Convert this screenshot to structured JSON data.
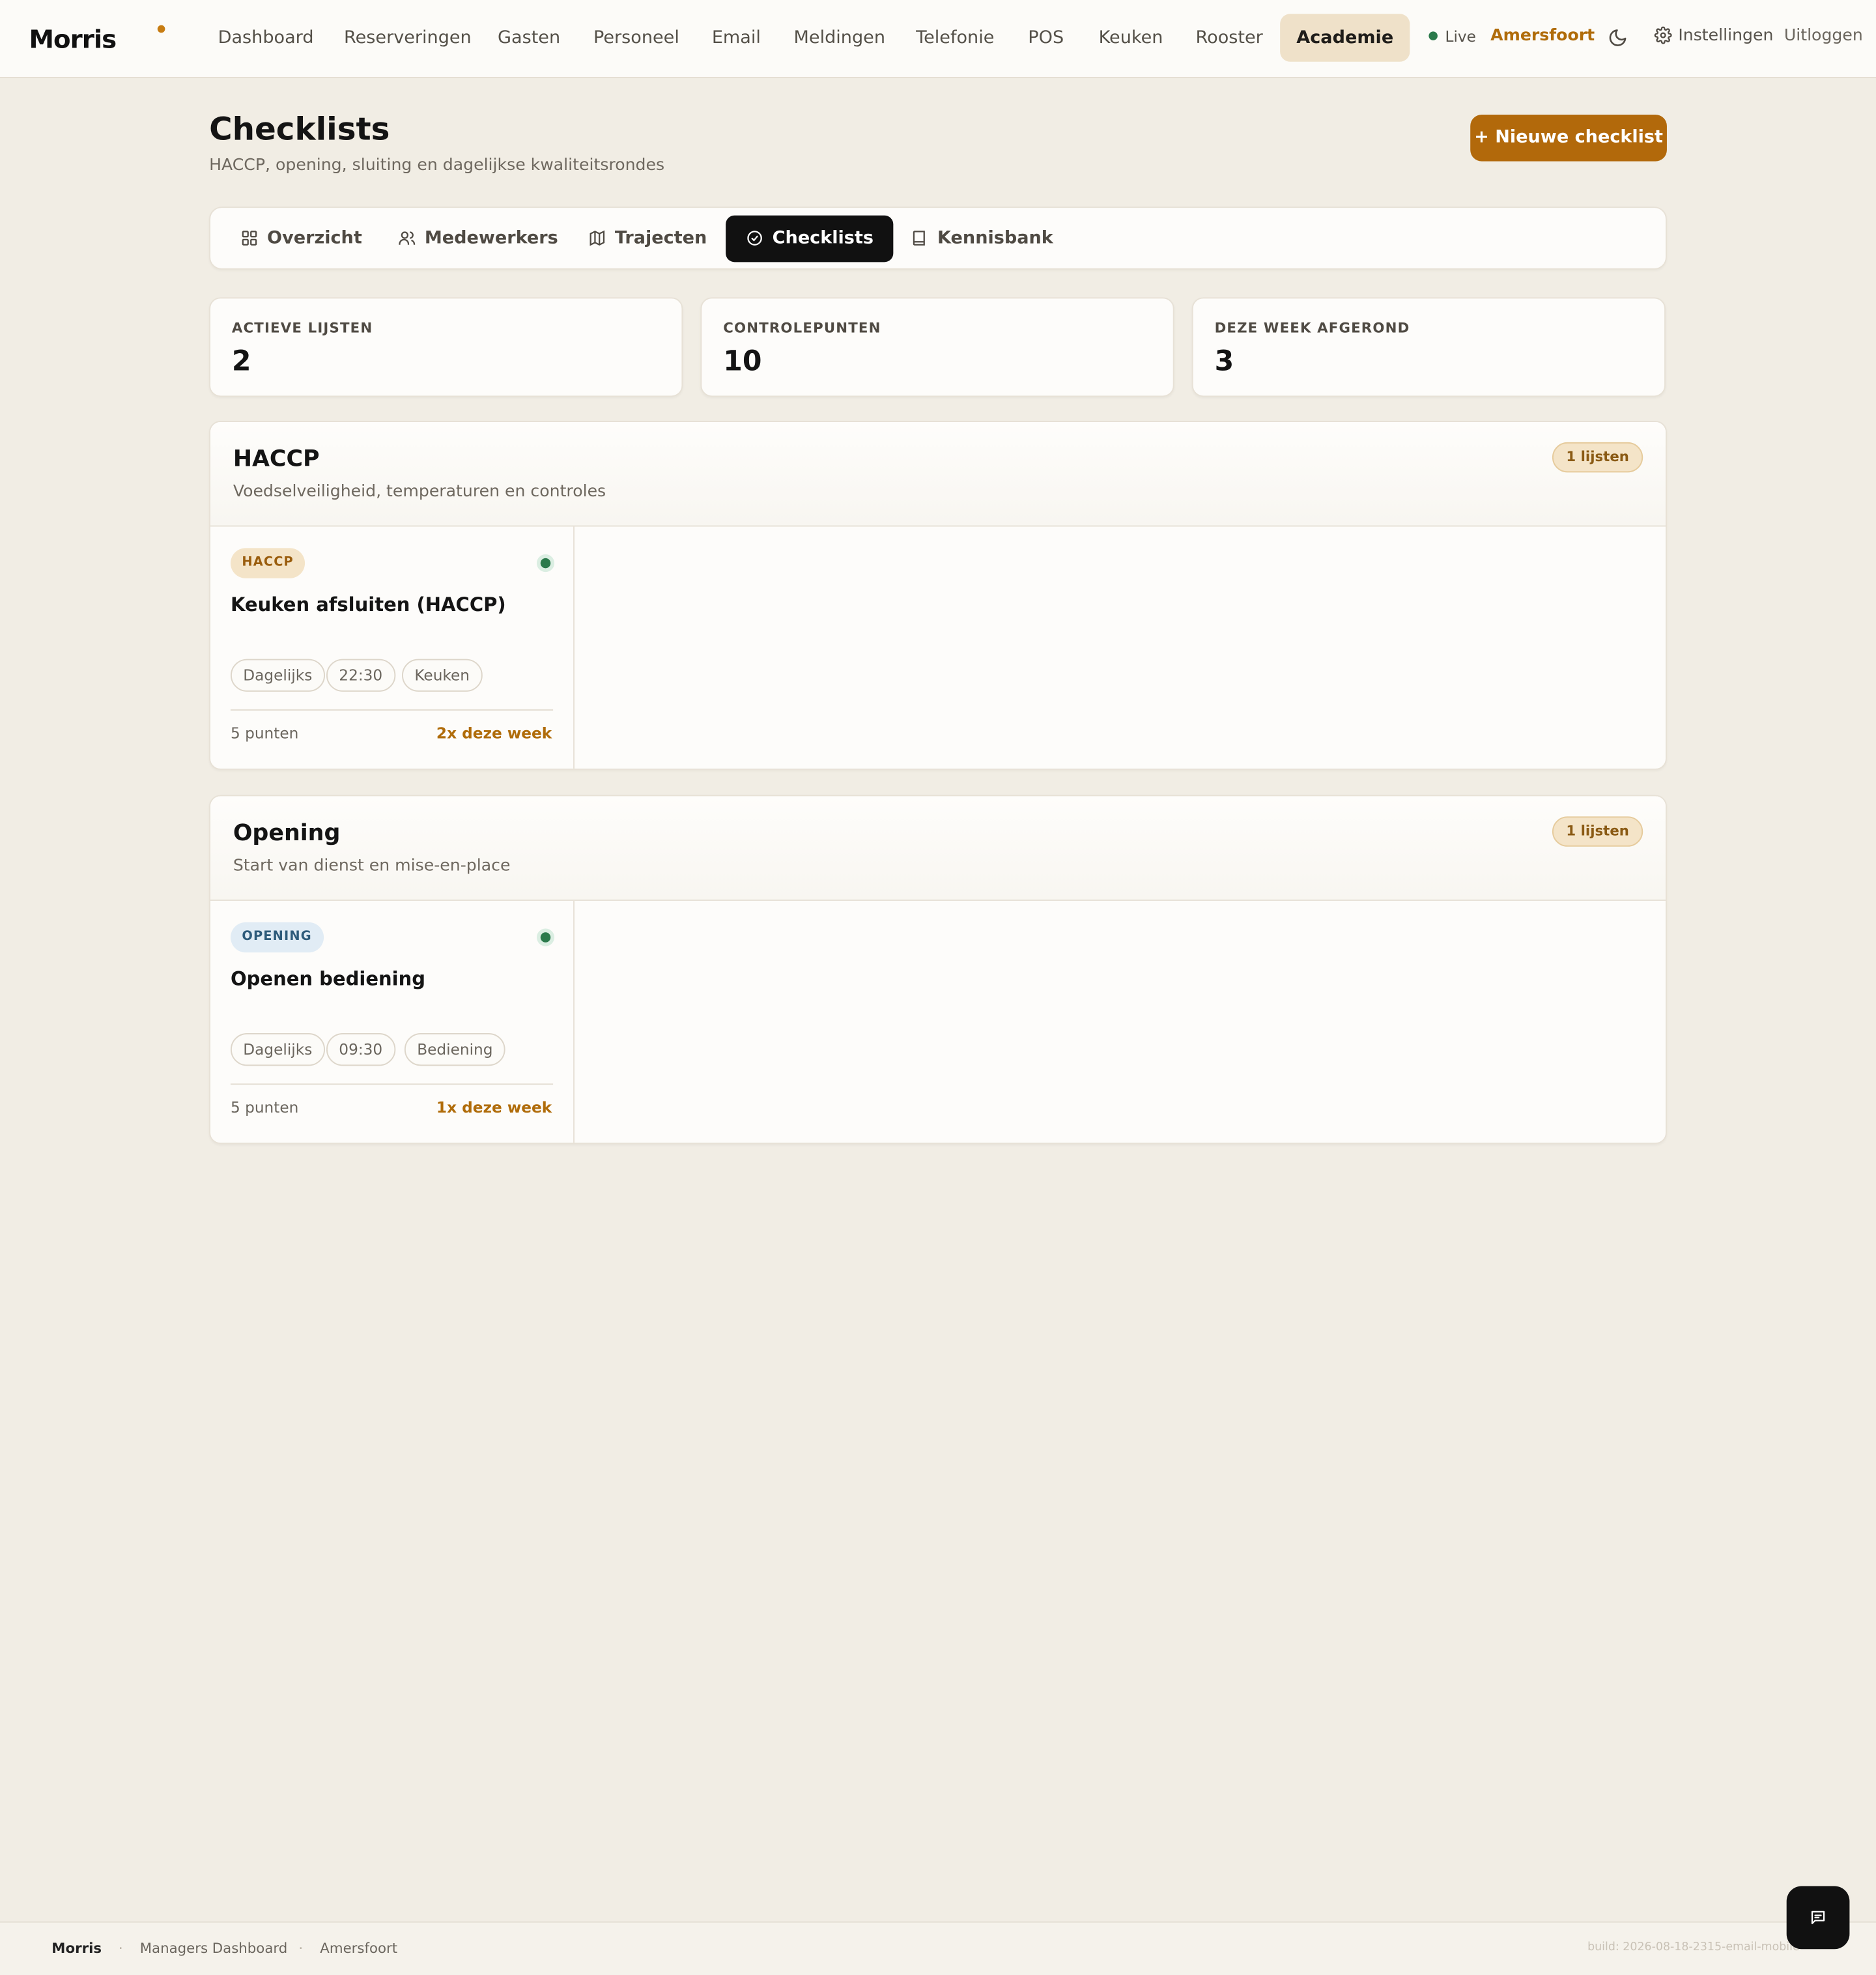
{
  "brand": "Morris",
  "nav": {
    "items": [
      "Dashboard",
      "Reserveringen",
      "Gasten",
      "Personeel",
      "Email",
      "Meldingen",
      "Telefonie",
      "POS",
      "Keuken",
      "Rooster",
      "Academie"
    ],
    "active": "Academie",
    "live_label": "Live",
    "location": "Amersfoort",
    "settings_label": "Instellingen",
    "logout_label": "Uitloggen"
  },
  "header": {
    "title": "Checklists",
    "subtitle": "HACCP, opening, sluiting en dagelijkse kwaliteitsrondes",
    "new_button": "+ Nieuwe checklist"
  },
  "tabs": [
    {
      "label": "Overzicht",
      "icon": "grid-icon"
    },
    {
      "label": "Medewerkers",
      "icon": "users-icon"
    },
    {
      "label": "Trajecten",
      "icon": "map-icon"
    },
    {
      "label": "Checklists",
      "icon": "check-circle-icon"
    },
    {
      "label": "Kennisbank",
      "icon": "book-icon"
    }
  ],
  "active_tab": "Checklists",
  "stats": [
    {
      "label": "ACTIEVE LIJSTEN",
      "value": "2"
    },
    {
      "label": "CONTROLEPUNTEN",
      "value": "10"
    },
    {
      "label": "DEZE WEEK AFGEROND",
      "value": "3"
    }
  ],
  "sections": [
    {
      "title": "HACCP",
      "subtitle": "Voedselveiligheid, temperaturen en controles",
      "badge": "1 lijsten",
      "card": {
        "chip": "HACCP",
        "title": "Keuken afsluiten (HACCP)",
        "tags": [
          "Dagelijks",
          "22:30",
          "Keuken"
        ],
        "points": "5 punten",
        "week": "2x deze week"
      }
    },
    {
      "title": "Opening",
      "subtitle": "Start van dienst en mise-en-place",
      "badge": "1 lijsten",
      "card": {
        "chip": "OPENING",
        "title": "Openen bediening",
        "tags": [
          "Dagelijks",
          "09:30",
          "Bediening"
        ],
        "points": "5 punten",
        "week": "1x deze week"
      }
    }
  ],
  "footer": {
    "brand": "Morris",
    "app": "Managers Dashboard",
    "location": "Amersfoort",
    "build": "build: 2026-08-18-2315-email-mobile"
  },
  "colors": {
    "accent": "#b2690b",
    "background": "#f1ede4",
    "status_green": "#2b7a4b"
  }
}
